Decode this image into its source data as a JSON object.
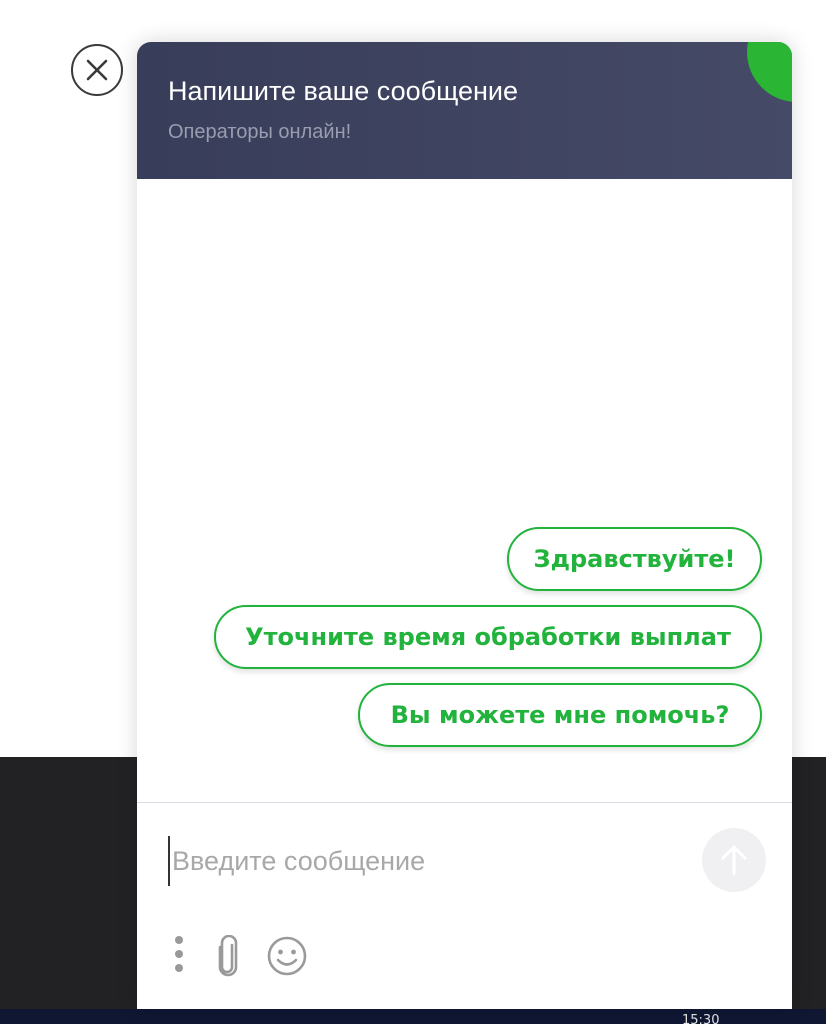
{
  "header": {
    "title": "Напишите ваше сообщение",
    "subtitle": "Операторы онлайн!"
  },
  "quick_replies": [
    {
      "label": "Здравствуйте!"
    },
    {
      "label": "Уточните время обработки выплат"
    },
    {
      "label": "Вы можете мне помочь?"
    }
  ],
  "composer": {
    "placeholder": "Введите сообщение"
  },
  "taskbar": {
    "time": "15:30"
  },
  "icons": {
    "close": "close-icon",
    "send": "arrow-up-icon",
    "more": "more-vertical-icon",
    "attach": "paperclip-icon",
    "emoji": "smiley-icon"
  },
  "colors": {
    "header_bg": "#3d4260",
    "accent_green": "#22b33c",
    "online_dot": "#2bb534"
  }
}
